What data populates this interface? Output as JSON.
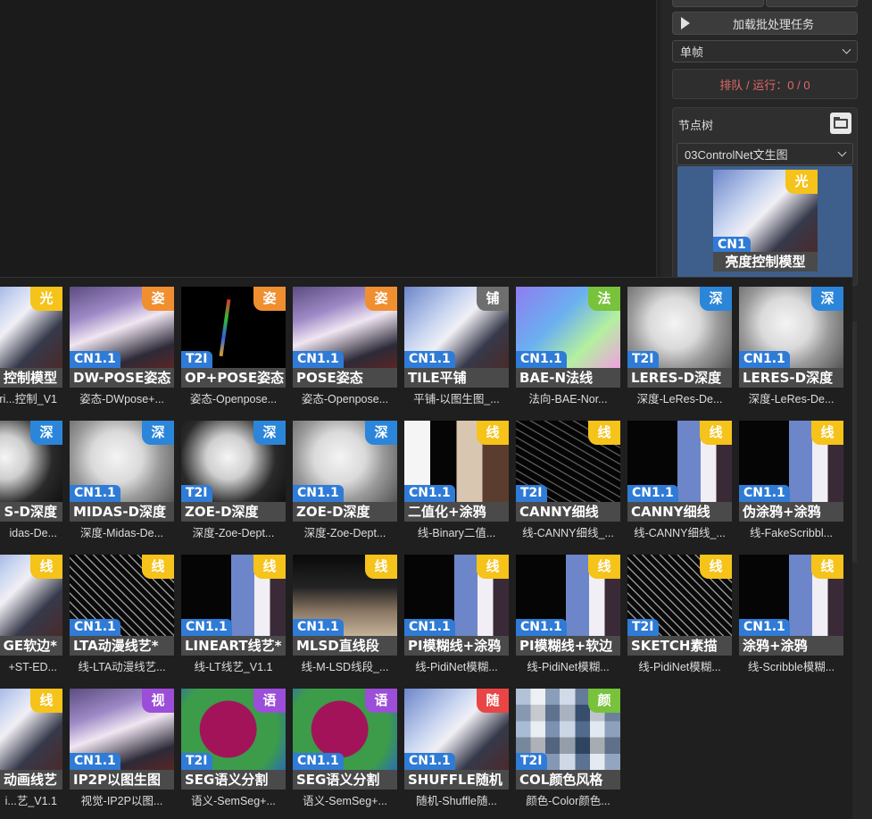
{
  "side_panel": {
    "batch_button_label": "加载批处理任务",
    "frame_mode": "单帧",
    "queue_status": "排队 / 运行：0 / 0",
    "node_tree_title": "节点树",
    "node_tree_selected": "03ControlNet文生图",
    "preview": {
      "badge": "光",
      "tag": "CN1",
      "caption": "亮度控制模型"
    }
  },
  "grid": {
    "cards": [
      {
        "caption": "控制模型",
        "sub": "ri...控制_V1",
        "tag": "",
        "badge": "光",
        "badge_color": "yellow",
        "art": "anime"
      },
      {
        "caption": "DW-POSE姿态",
        "sub": "姿态-DWpose+...",
        "tag": "CN1.1",
        "badge": "姿",
        "badge_color": "orange",
        "art": "anime2"
      },
      {
        "caption": "OP+POSE姿态",
        "sub": "姿态-Openpose...",
        "tag": "T2I",
        "badge": "姿",
        "badge_color": "orange",
        "art": "pose"
      },
      {
        "caption": "POSE姿态",
        "sub": "姿态-Openpose...",
        "tag": "CN1.1",
        "badge": "姿",
        "badge_color": "orange",
        "art": "anime2"
      },
      {
        "caption": "TILE平铺",
        "sub": "平铺-以图生图_...",
        "tag": "CN1.1",
        "badge": "铺",
        "badge_color": "gray",
        "art": "anime"
      },
      {
        "caption": "BAE-N法线",
        "sub": "法向-BAE-Nor...",
        "tag": "CN1.1",
        "badge": "法",
        "badge_color": "green",
        "art": "normal"
      },
      {
        "caption": "LERES-D深度",
        "sub": "深度-LeRes-De...",
        "tag": "T2I",
        "badge": "深",
        "badge_color": "blue",
        "art": "depth"
      },
      {
        "caption": "LERES-D深度",
        "sub": "深度-LeRes-De...",
        "tag": "CN1.1",
        "badge": "深",
        "badge_color": "blue",
        "art": "depth"
      },
      {
        "caption": "S-D深度",
        "sub": "idas-De...",
        "tag": "",
        "badge": "深",
        "badge_color": "blue",
        "art": "depthdark"
      },
      {
        "caption": "MIDAS-D深度",
        "sub": "深度-Midas-De...",
        "tag": "CN1.1",
        "badge": "深",
        "badge_color": "blue",
        "art": "depth"
      },
      {
        "caption": "ZOE-D深度",
        "sub": "深度-Zoe-Dept...",
        "tag": "T2I",
        "badge": "深",
        "badge_color": "blue",
        "art": "depthdark"
      },
      {
        "caption": "ZOE-D深度",
        "sub": "深度-Zoe-Dept...",
        "tag": "CN1.1",
        "badge": "深",
        "badge_color": "blue",
        "art": "depth"
      },
      {
        "caption": "二值化+涂鸦",
        "sub": "线-Binary二值...",
        "tag": "CN1.1",
        "badge": "线",
        "badge_color": "yellow",
        "art": "bin"
      },
      {
        "caption": "CANNY细线",
        "sub": "线-CANNY细线_...",
        "tag": "T2I",
        "badge": "线",
        "badge_color": "yellow",
        "art": "linesdark"
      },
      {
        "caption": "CANNY细线",
        "sub": "线-CANNY细线_...",
        "tag": "CN1.1",
        "badge": "线",
        "badge_color": "yellow",
        "art": "split"
      },
      {
        "caption": "伪涂鸦+涂鸦",
        "sub": "线-FakeScribbl...",
        "tag": "CN1.1",
        "badge": "线",
        "badge_color": "yellow",
        "art": "split"
      },
      {
        "caption": "GE软边*",
        "sub": "+ST-ED...",
        "tag": "",
        "badge": "线",
        "badge_color": "yellow",
        "art": "anime"
      },
      {
        "caption": "LTA动漫线艺*",
        "sub": "线-LTA动漫线艺...",
        "tag": "CN1.1",
        "badge": "线",
        "badge_color": "yellow",
        "art": "lines"
      },
      {
        "caption": "LINEART线艺*",
        "sub": "线-LT线艺_V1.1",
        "tag": "CN1.1",
        "badge": "线",
        "badge_color": "yellow",
        "art": "split"
      },
      {
        "caption": "MLSD直线段",
        "sub": "线-M-LSD线段_...",
        "tag": "CN1.1",
        "badge": "线",
        "badge_color": "yellow",
        "art": "room"
      },
      {
        "caption": "PI模糊线+涂鸦",
        "sub": "线-PidiNet模糊...",
        "tag": "CN1.1",
        "badge": "线",
        "badge_color": "yellow",
        "art": "split"
      },
      {
        "caption": "PI模糊线+软边",
        "sub": "线-PidiNet模糊...",
        "tag": "CN1.1",
        "badge": "线",
        "badge_color": "yellow",
        "art": "split"
      },
      {
        "caption": "SKETCH素描",
        "sub": "线-PidiNet模糊...",
        "tag": "T2I",
        "badge": "线",
        "badge_color": "yellow",
        "art": "lines"
      },
      {
        "caption": "涂鸦+涂鸦",
        "sub": "线-Scribble模糊...",
        "tag": "CN1.1",
        "badge": "线",
        "badge_color": "yellow",
        "art": "split"
      },
      {
        "caption": "动画线艺",
        "sub": "i...艺_V1.1",
        "tag": "",
        "badge": "线",
        "badge_color": "yellow",
        "art": "anime"
      },
      {
        "caption": "IP2P以图生图",
        "sub": "视觉-IP2P以图...",
        "tag": "CN1.1",
        "badge": "视",
        "badge_color": "purple",
        "art": "anime2"
      },
      {
        "caption": "SEG语义分割",
        "sub": "语义-SemSeg+...",
        "tag": "T2I",
        "badge": "语",
        "badge_color": "purple",
        "art": "seg"
      },
      {
        "caption": "SEG语义分割",
        "sub": "语义-SemSeg+...",
        "tag": "CN1.1",
        "badge": "语",
        "badge_color": "purple",
        "art": "seg"
      },
      {
        "caption": "SHUFFLE随机",
        "sub": "随机-Shuffle随...",
        "tag": "CN1.1",
        "badge": "随",
        "badge_color": "red",
        "art": "anime"
      },
      {
        "caption": "COL颜色风格",
        "sub": "颜色-Color颜色...",
        "tag": "T2I",
        "badge": "颜",
        "badge_color": "green",
        "art": "pixel"
      }
    ]
  }
}
